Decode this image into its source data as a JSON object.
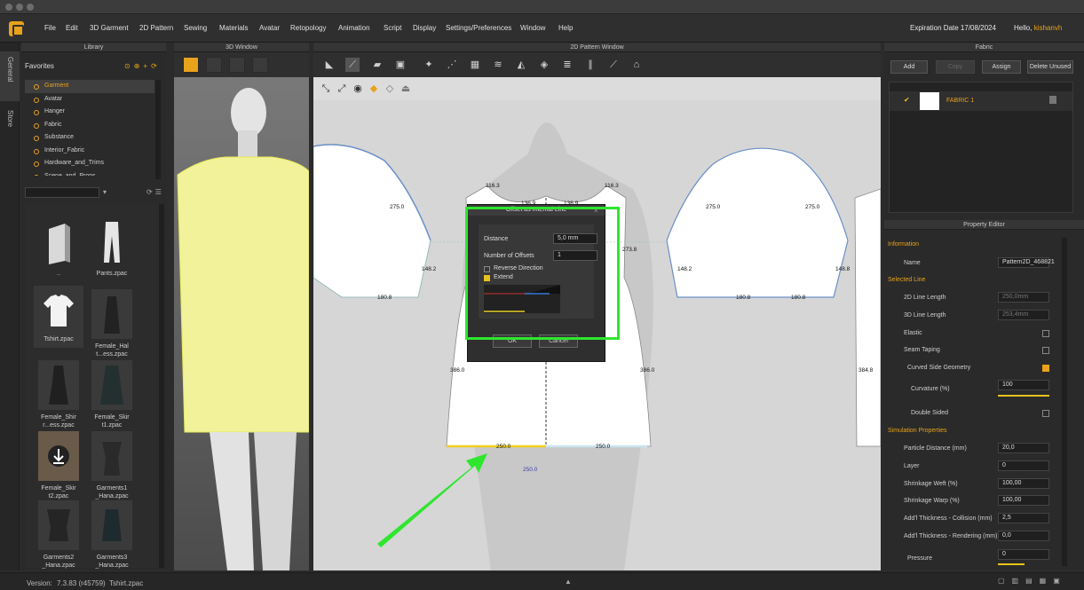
{
  "menu": {
    "items": [
      "File",
      "Edit",
      "3D Garment",
      "2D Pattern",
      "Sewing",
      "Materials",
      "Avatar",
      "Retopology",
      "Animation",
      "Script",
      "Display",
      "Settings/Preferences",
      "Window",
      "Help"
    ],
    "expiration": "Expiration Date 17/08/2024",
    "hello_prefix": "Hello, ",
    "username": "kishanvh"
  },
  "side_tabs": [
    "General",
    "Store"
  ],
  "library": {
    "title": "Library",
    "favorites_label": "Favorites",
    "tree": [
      "Garment",
      "Avatar",
      "Hanger",
      "Fabric",
      "Substance",
      "Interior_Fabric",
      "Hardware_and_Trims",
      "Scene_and_Props"
    ],
    "selected": "Garment",
    "files": [
      {
        "name": "..",
        "icon": "folder-icon"
      },
      {
        "name": "Pants.zpac",
        "icon": "pants-icon"
      },
      {
        "name": "Tshirt.zpac",
        "icon": "tshirt-icon"
      },
      {
        "name": "Female_Hal\nt...ess.zpac",
        "icon": "dress-icon"
      },
      {
        "name": "Female_Shir\nr...ess.zpac",
        "icon": "dress-icon"
      },
      {
        "name": "Female_Skir\nt1.zpac",
        "icon": "skirt-icon"
      },
      {
        "name": "Female_Skir\nt2.zpac",
        "icon": "download-icon"
      },
      {
        "name": "Garments1\n_Hana.zpac",
        "icon": "garment-icon"
      },
      {
        "name": "Garments2\n_Hana.zpac",
        "icon": "garment-icon"
      },
      {
        "name": "Garments3\n_Hana.zpac",
        "icon": "garment-icon"
      }
    ]
  },
  "window3d": {
    "title": "3D Window"
  },
  "window2d": {
    "title": "2D Pattern Window",
    "measurements": [
      "116.3",
      "136.9",
      "136.9",
      "116.3",
      "275.0",
      "275.0",
      "275.0",
      "273.8",
      "148.2",
      "148.2",
      "148.8",
      "180.8",
      "180.8",
      "180.8",
      "386.0",
      "386.0",
      "384.8",
      "250.0",
      "250.0",
      "250.0"
    ]
  },
  "dialog": {
    "title": "Offset as Internal Line",
    "distance_label": "Distance",
    "distance_value": "5,0 mm",
    "offsets_label": "Number of Offsets",
    "offsets_value": "1",
    "reverse_label": "Reverse Direction",
    "extend_label": "Extend",
    "ok": "OK",
    "cancel": "Cancel"
  },
  "fabric": {
    "title": "Fabric",
    "buttons": [
      "Add",
      "Copy",
      "Assign",
      "Delete Unused"
    ],
    "item": "FABRIC 1"
  },
  "property_editor": {
    "title": "Property Editor",
    "information": "Information",
    "name_label": "Name",
    "name_value": "Pattern2D_468821",
    "selected_line": "Selected Line",
    "line2d_label": "2D Line Length",
    "line2d_value": "250,0mm",
    "line3d_label": "3D Line Length",
    "line3d_value": "253,4mm",
    "elastic": "Elastic",
    "seam_taping": "Seam Taping",
    "curved": "Curved Side Geometry",
    "curvature_label": "Curvature (%)",
    "curvature_value": "100",
    "double_sided": "Double Sided",
    "sim_props": "Simulation Properties",
    "particle_label": "Particle Distance (mm)",
    "particle_value": "20,0",
    "layer_label": "Layer",
    "layer_value": "0",
    "weft_label": "Shrinkage Weft (%)",
    "weft_value": "100,00",
    "warp_label": "Shrinkage Warp (%)",
    "warp_value": "100,00",
    "coll_label": "Add'l Thickness - Collision (mm)",
    "coll_value": "2,5",
    "rend_label": "Add'l Thickness - Rendering (mm)",
    "rend_value": "0,0",
    "pressure_label": "Pressure",
    "pressure_value": "0"
  },
  "status": {
    "version_label": "Version:",
    "version": "7.3.83 (r45759)",
    "file": "Tshirt.zpac"
  },
  "colors": {
    "accent": "#e8a21c",
    "highlight": "#2ee62e"
  }
}
